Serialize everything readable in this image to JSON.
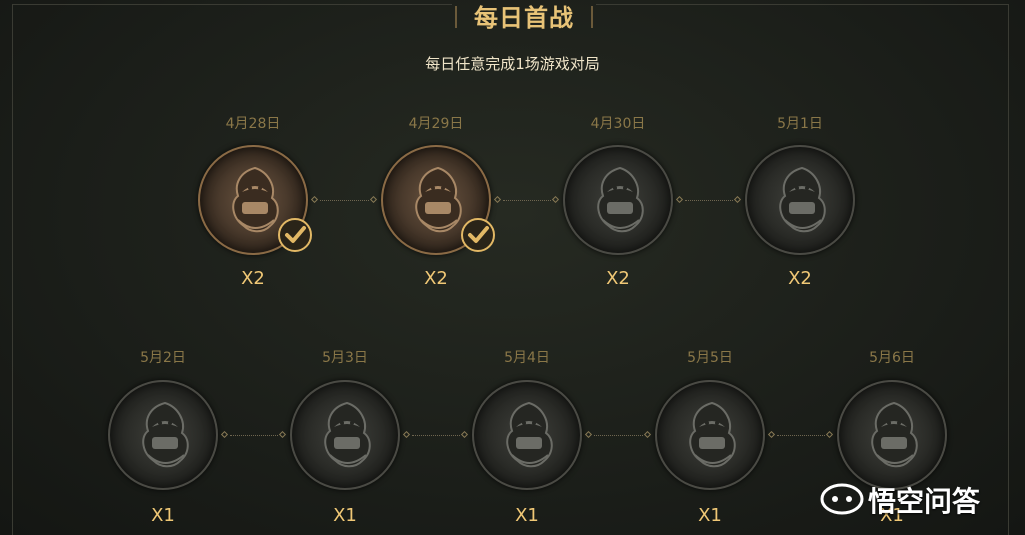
{
  "header": {
    "title": "每日首战",
    "subtitle": "每日任意完成1场游戏对局"
  },
  "days": [
    {
      "date": "4月28日",
      "reward": "X2",
      "completed": true
    },
    {
      "date": "4月29日",
      "reward": "X2",
      "completed": true
    },
    {
      "date": "4月30日",
      "reward": "X2",
      "completed": false
    },
    {
      "date": "5月1日",
      "reward": "X2",
      "completed": false
    },
    {
      "date": "5月2日",
      "reward": "X1",
      "completed": false
    },
    {
      "date": "5月3日",
      "reward": "X1",
      "completed": false
    },
    {
      "date": "5月4日",
      "reward": "X1",
      "completed": false
    },
    {
      "date": "5月5日",
      "reward": "X1",
      "completed": false
    },
    {
      "date": "5月6日",
      "reward": "X1",
      "completed": false
    }
  ],
  "icons": {
    "coin": "dragon-coin-icon",
    "check": "check-icon"
  },
  "colors": {
    "gold": "#e8c377",
    "reward": "#f0c876",
    "date": "#8a7748",
    "background": "#1c1f1a"
  },
  "watermark": {
    "text": "悟空问答"
  }
}
